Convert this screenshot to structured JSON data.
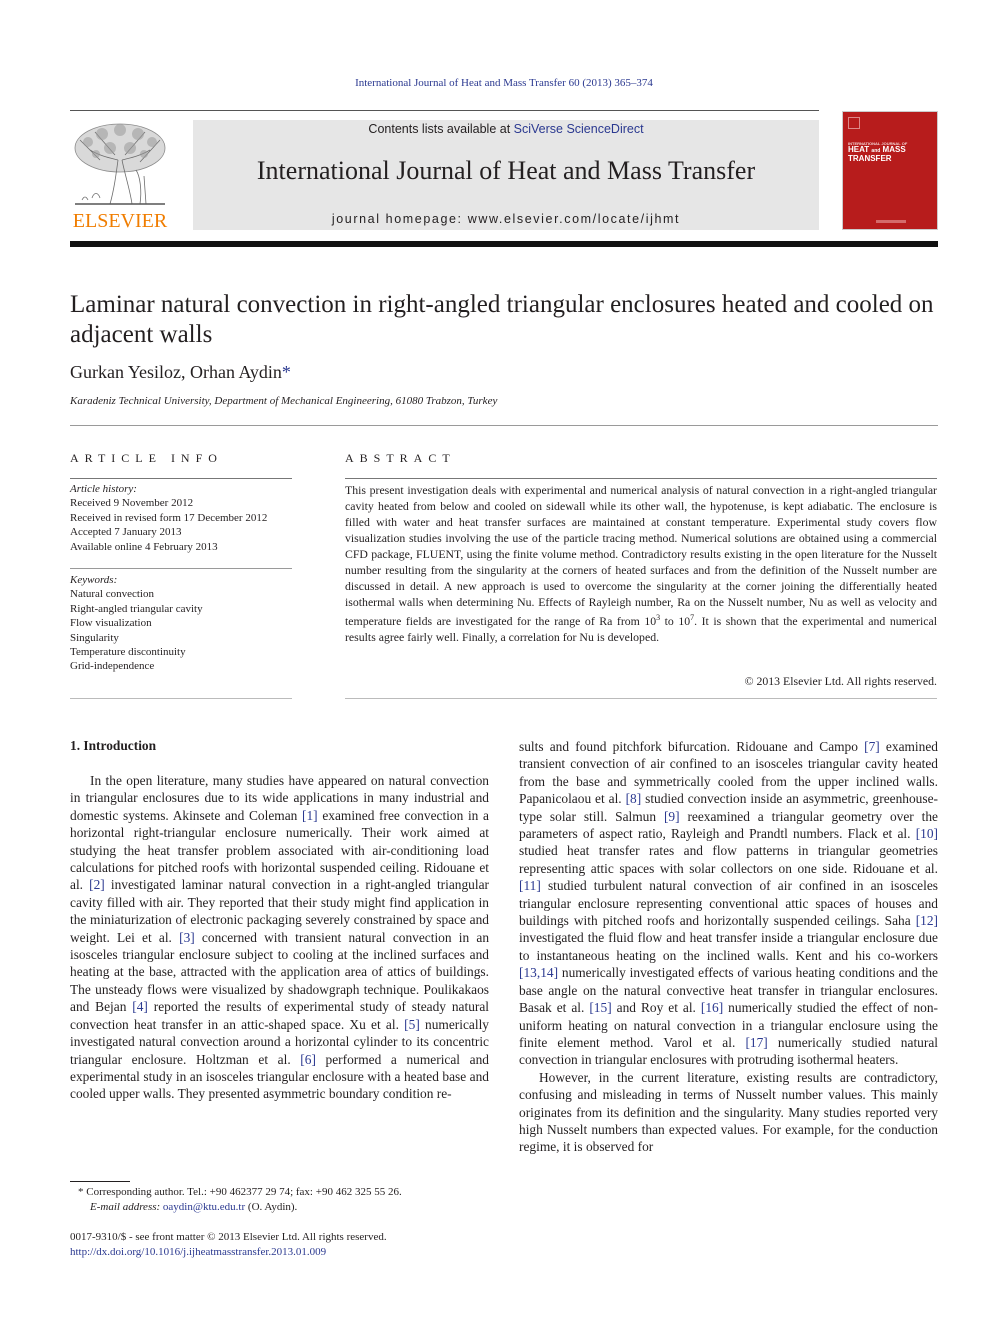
{
  "header": {
    "journal_ref": "International Journal of Heat and Mass Transfer 60 (2013) 365–374",
    "contents_prefix": "Contents lists available at ",
    "contents_link": "SciVerse ScienceDirect",
    "journal_title": "International Journal of Heat and Mass Transfer",
    "homepage": "journal homepage: www.elsevier.com/locate/ijhmt",
    "publisher_logo_text": "ELSEVIER",
    "cover": {
      "small_text": "INTERNATIONAL JOURNAL OF",
      "title_line1": "HEAT",
      "title_and": "and",
      "title_line1b": "MASS",
      "title_line2": "TRANSFER",
      "bg_color": "#b71c1c"
    },
    "accent_orange": "#f07d00",
    "link_color": "#2b3990"
  },
  "article": {
    "title": "Laminar natural convection in right-angled triangular enclosures heated and cooled on adjacent walls",
    "authors": "Gurkan Yesiloz, Orhan Aydin",
    "corresponding_mark": "*",
    "affiliation": "Karadeniz Technical University, Department of Mechanical Engineering, 61080 Trabzon, Turkey"
  },
  "article_info": {
    "heading": "ARTICLE INFO",
    "history_label": "Article history:",
    "history": [
      "Received 9 November 2012",
      "Received in revised form 17 December 2012",
      "Accepted 7 January 2013",
      "Available online 4 February 2013"
    ],
    "keywords_label": "Keywords:",
    "keywords": [
      "Natural convection",
      "Right-angled triangular cavity",
      "Flow visualization",
      "Singularity",
      "Temperature discontinuity",
      "Grid-independence"
    ]
  },
  "abstract": {
    "heading": "ABSTRACT",
    "text_part1": "This present investigation deals with experimental and numerical analysis of natural convection in a right-angled triangular cavity heated from below and cooled on sidewall while its other wall, the hypotenuse, is kept adiabatic. The enclosure is filled with water and heat transfer surfaces are maintained at constant temperature. Experimental study covers flow visualization studies involving the use of the particle tracing method. Numerical solutions are obtained using a commercial CFD package, FLUENT, using the finite volume method. Contradictory results existing in the open literature for the Nusselt number resulting from the singularity at the corners of heated surfaces and from the definition of the Nusselt number are discussed in detail. A new approach is used to overcome the singularity at the corner joining the differentially heated isothermal walls when determining Nu. Effects of Rayleigh number, Ra on the Nusselt number, Nu as well as velocity and temperature fields are investigated for the range of Ra from ",
    "ra_low_base": "10",
    "ra_low_exp": "3",
    "to_word": " to ",
    "ra_high_base": "10",
    "ra_high_exp": "7",
    "text_part2": ". It is shown that the experimental and numerical results agree fairly well. Finally, a correlation for Nu is developed.",
    "copyright": "© 2013 Elsevier Ltd. All rights reserved."
  },
  "body": {
    "section_heading": "1. Introduction",
    "left_column": [
      {
        "t": "In the open literature, many studies have appeared on natural convection in triangular enclosures due to its wide applications in many industrial and domestic systems. Akinsete and Coleman "
      },
      {
        "r": "[1]"
      },
      {
        "t": " examined free convection in a horizontal right-triangular enclosure numerically. Their work aimed at studying the heat transfer problem associated with air-conditioning load calculations for pitched roofs with horizontal suspended ceiling. Ridouane et al. "
      },
      {
        "r": "[2]"
      },
      {
        "t": " investigated laminar natural convection in a right-angled triangular cavity filled with air. They reported that their study might find application in the miniaturization of electronic packaging severely constrained by space and weight. Lei et al. "
      },
      {
        "r": "[3]"
      },
      {
        "t": " concerned with transient natural convection in an isosceles triangular enclosure subject to cooling at the inclined surfaces and heating at the base, attracted with the application area of attics of buildings. The unsteady flows were visualized by shadowgraph technique. Poulikakaos and Bejan "
      },
      {
        "r": "[4]"
      },
      {
        "t": " reported the results of experimental study of steady natural convection heat transfer in an attic-shaped space. Xu et al. "
      },
      {
        "r": "[5]"
      },
      {
        "t": " numerically investigated natural convection around a horizontal cylinder to its concentric triangular enclosure. Holtzman et al. "
      },
      {
        "r": "[6]"
      },
      {
        "t": " performed a numerical and experimental study in an isosceles triangular enclosure with a heated base and cooled upper walls. They presented asymmetric boundary condition re-"
      }
    ],
    "right_column_p1": [
      {
        "t": "sults and found pitchfork bifurcation. Ridouane and Campo "
      },
      {
        "r": "[7]"
      },
      {
        "t": " examined transient convection of air confined to an isosceles triangular cavity heated from the base and symmetrically cooled from the upper inclined walls. Papanicolaou et al. "
      },
      {
        "r": "[8]"
      },
      {
        "t": " studied convection inside an asymmetric, greenhouse-type solar still. Salmun "
      },
      {
        "r": "[9]"
      },
      {
        "t": " reexamined a triangular geometry over the parameters of aspect ratio, Rayleigh and Prandtl numbers. Flack et al. "
      },
      {
        "r": "[10]"
      },
      {
        "t": " studied heat transfer rates and flow patterns in triangular geometries representing attic spaces with solar collectors on one side. Ridouane et al. "
      },
      {
        "r": "[11]"
      },
      {
        "t": " studied turbulent natural convection of air confined in an isosceles triangular enclosure representing conventional attic spaces of houses and buildings with pitched roofs and horizontally suspended ceilings. Saha "
      },
      {
        "r": "[12]"
      },
      {
        "t": " investigated the fluid flow and heat transfer inside a triangular enclosure due to instantaneous heating on the inclined walls. Kent and his co-workers "
      },
      {
        "r": "[13,14]"
      },
      {
        "t": " numerically investigated effects of various heating conditions and the base angle on the natural convective heat transfer in triangular enclosures. Basak et al. "
      },
      {
        "r": "[15]"
      },
      {
        "t": " and Roy et al. "
      },
      {
        "r": "[16]"
      },
      {
        "t": " numerically studied the effect of non-uniform heating on natural convection in a triangular enclosure using the finite element method. Varol et al. "
      },
      {
        "r": "[17]"
      },
      {
        "t": " numerically studied natural convection in triangular enclosures with protruding isothermal heaters."
      }
    ],
    "right_column_p2": "However, in the current literature, existing results are contradictory, confusing and misleading in terms of Nusselt number values. This mainly originates from its definition and the singularity. Many studies reported very high Nusselt numbers than expected values. For example, for the conduction regime, it is observed for"
  },
  "footnote": {
    "mark": "*",
    "corresponding": " Corresponding author. Tel.: +90 462377 29 74; fax: +90 462 325 55 26.",
    "email_label": "E-mail address:",
    "email": "oaydin@ktu.edu.tr",
    "email_suffix": " (O. Aydin).",
    "issn_line": "0017-9310/$ - see front matter © 2013 Elsevier Ltd. All rights reserved.",
    "doi": "http://dx.doi.org/10.1016/j.ijheatmasstransfer.2013.01.009"
  }
}
